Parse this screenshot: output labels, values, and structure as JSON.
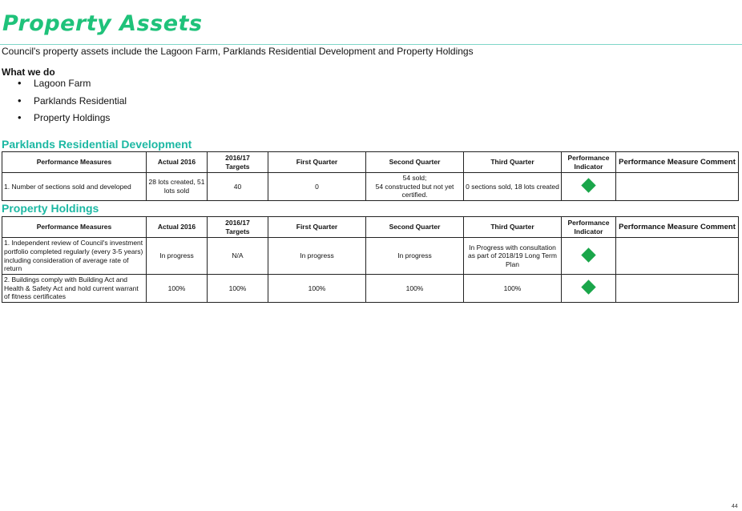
{
  "page": {
    "title": "Property Assets",
    "intro": "Council's property assets include the Lagoon Farm, Parklands Residential Development and Property Holdings",
    "what_we_do_heading": "What we do",
    "what_we_do": [
      "Lagoon Farm",
      "Parklands Residential",
      "Property Holdings"
    ],
    "bullet_glyph": "•",
    "page_number": "44"
  },
  "headers": {
    "measures": "Performance Measures",
    "actual": "Actual 2016",
    "targets_line1": "2016/17",
    "targets_line2": "Targets",
    "q1": "First Quarter",
    "q2": "Second Quarter",
    "q3": "Third Quarter",
    "indicator_line1": "Performance",
    "indicator_line2": "Indicator",
    "comment": "Performance Measure Comment"
  },
  "indicator_color": "#1aa64a",
  "sections": [
    {
      "title": "Parklands Residential Development",
      "rows": [
        {
          "measure": "1. Number of sections sold and developed",
          "actual": "28 lots created, 51 lots sold",
          "target": "40",
          "q1": "0",
          "q2_line1": "54 sold;",
          "q2_line2": "54 constructed but not yet certified.",
          "q3": "0 sections sold, 18 lots created",
          "indicator": "green-diamond-icon",
          "comment": ""
        }
      ]
    },
    {
      "title": "Property Holdings",
      "rows": [
        {
          "measure": "1. Independent review of Council's investment portfolio completed regularly (every 3-5 years) including consideration of average rate of return",
          "actual": "In progress",
          "target": "N/A",
          "q1": "In progress",
          "q2": "In progress",
          "q3": "In Progress with consultation as part of 2018/19 Long Term Plan",
          "indicator": "green-diamond-icon",
          "comment": ""
        },
        {
          "measure": "2. Buildings comply with Building Act and Health & Safety Act and hold current warrant of fitness certificates",
          "actual": "100%",
          "target": "100%",
          "q1": "100%",
          "q2": "100%",
          "q3": "100%",
          "indicator": "green-diamond-icon",
          "comment": ""
        }
      ]
    }
  ]
}
